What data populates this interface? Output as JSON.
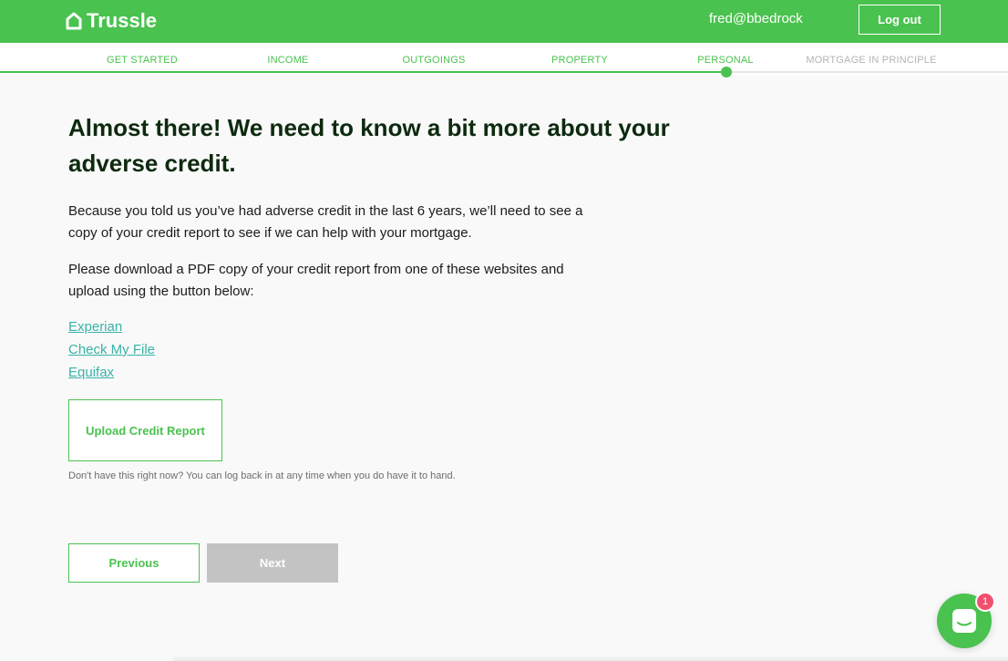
{
  "header": {
    "brand": "Trussle",
    "user_email": "fred@bbedrock",
    "logout_label": "Log out",
    "brand_color": "#4ac24f"
  },
  "steps": [
    {
      "label": "GET STARTED",
      "state": "done"
    },
    {
      "label": "INCOME",
      "state": "done"
    },
    {
      "label": "OUTGOINGS",
      "state": "done"
    },
    {
      "label": "PROPERTY",
      "state": "done"
    },
    {
      "label": "PERSONAL",
      "state": "current"
    },
    {
      "label": "MORTGAGE IN PRINCIPLE",
      "state": "upcoming"
    }
  ],
  "main": {
    "title": "Almost there! We need to know a bit more about your adverse credit.",
    "paragraph1": "Because you told us you’ve had adverse credit in the last 6 years, we’ll need to see a copy of your credit report to see if we can help with your mortgage.",
    "paragraph2": "Please download a PDF copy of your credit report from one of these websites and upload using the button below:",
    "links": [
      "Experian",
      "Check My File",
      "Equifax"
    ],
    "upload_label": "Upload Credit Report",
    "hint": "Don't have this right now? You can log back in at any time when you do have it to hand."
  },
  "nav": {
    "previous_label": "Previous",
    "next_label": "Next"
  },
  "chat": {
    "icon": "chat-icon",
    "badge_count": "1"
  }
}
